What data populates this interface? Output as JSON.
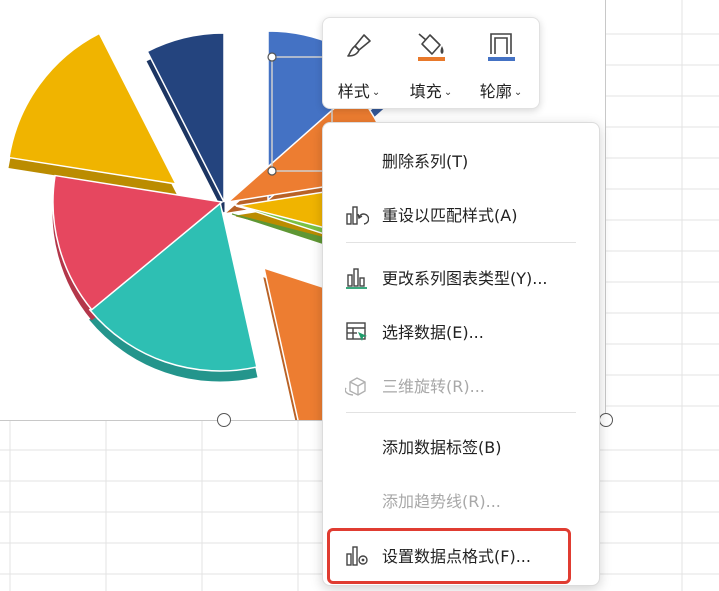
{
  "toolbar": {
    "buttons": [
      {
        "label": "样式",
        "icon": "brush-icon"
      },
      {
        "label": "填充",
        "icon": "fill-bucket-icon",
        "accent": "#e8792b"
      },
      {
        "label": "轮廓",
        "icon": "outline-icon",
        "accent": "#4472c4"
      }
    ]
  },
  "chart_data": {
    "type": "pie",
    "title": "",
    "slices": [
      {
        "color": "#4472c4",
        "fraction": 0.135
      },
      {
        "color": "#ed7d31",
        "fraction": 0.09
      },
      {
        "color": "#f0b400",
        "fraction": 0.065
      },
      {
        "color": "#7ac143",
        "fraction": 0.01
      },
      {
        "color": "#ed7d31",
        "fraction": 0.165
      },
      {
        "color": "#2ebfb3",
        "fraction": 0.175
      },
      {
        "color": "#e6475f",
        "fraction": 0.135
      },
      {
        "color": "#f0b400",
        "fraction": 0.15
      },
      {
        "color": "#24447e",
        "fraction": 0.075
      }
    ]
  },
  "menu": {
    "items": [
      {
        "label": "删除系列(T)",
        "icon": "",
        "disabled": false
      },
      {
        "label": "重设以匹配样式(A)",
        "icon": "reset-chart-style-icon",
        "disabled": false
      },
      {
        "label": "更改系列图表类型(Y)...",
        "icon": "change-chart-type-icon",
        "disabled": false
      },
      {
        "label": "选择数据(E)...",
        "icon": "select-data-icon",
        "disabled": false
      },
      {
        "label": "三维旋转(R)...",
        "icon": "rotate-3d-icon",
        "disabled": true
      },
      {
        "label": "添加数据标签(B)",
        "icon": "",
        "disabled": false
      },
      {
        "label": "添加趋势线(R)...",
        "icon": "",
        "disabled": true
      },
      {
        "label": "设置数据点格式(F)...",
        "icon": "format-data-point-icon",
        "disabled": false
      }
    ]
  },
  "colors": {
    "highlight": "#e03c31",
    "accent_blue": "#4472c4",
    "accent_orange": "#e8792b"
  }
}
